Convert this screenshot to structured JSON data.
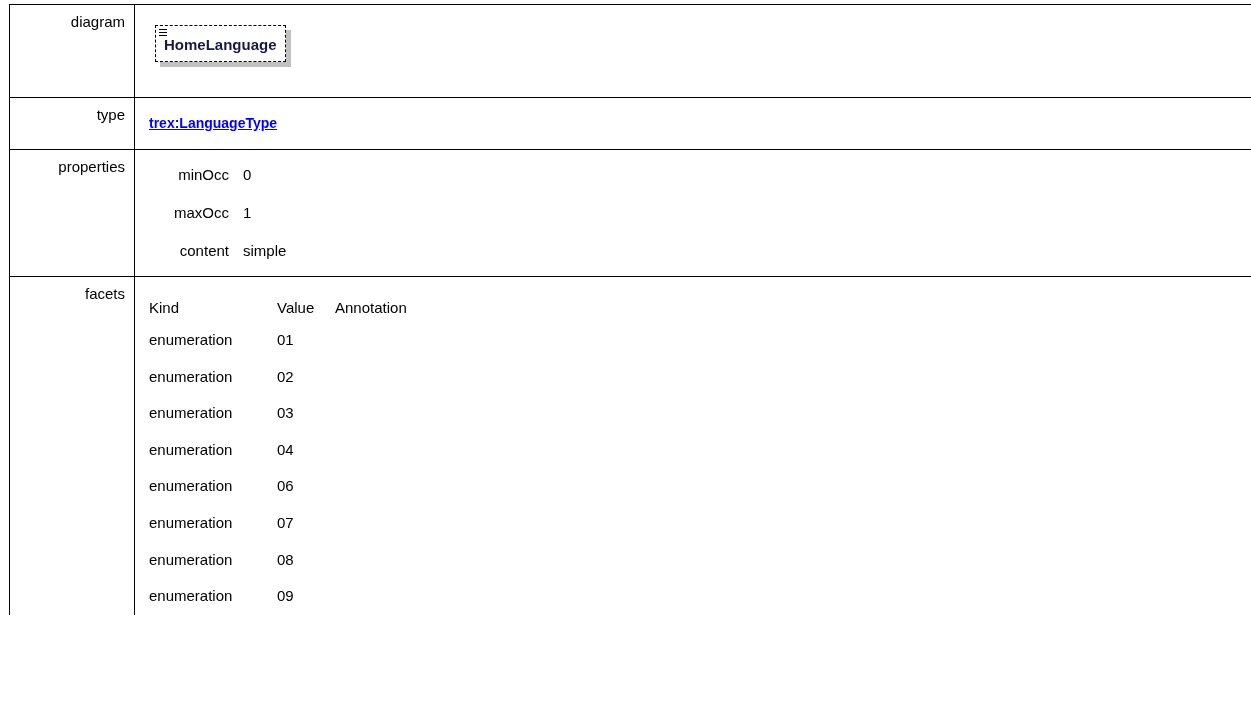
{
  "rows": [
    {
      "kind": "diagram",
      "label": "diagram",
      "element": "HomeLanguage"
    },
    {
      "kind": "link",
      "label": "type",
      "link": "trex:LanguageType"
    },
    {
      "kind": "properties",
      "label": "properties",
      "properties": [
        {
          "name": "minOcc",
          "value": "0"
        },
        {
          "name": "maxOcc",
          "value": "1"
        },
        {
          "name": "content",
          "value": "simple"
        }
      ]
    },
    {
      "kind": "facets",
      "label": "facets",
      "columns": [
        "Kind",
        "Value",
        "Annotation"
      ],
      "facets": [
        {
          "kind": "enumeration",
          "value": "01"
        },
        {
          "kind": "enumeration",
          "value": "02"
        },
        {
          "kind": "enumeration",
          "value": "03"
        },
        {
          "kind": "enumeration",
          "value": "04"
        },
        {
          "kind": "enumeration",
          "value": "06"
        },
        {
          "kind": "enumeration",
          "value": "07"
        },
        {
          "kind": "enumeration",
          "value": "08"
        },
        {
          "kind": "enumeration",
          "value": "09"
        }
      ]
    }
  ]
}
